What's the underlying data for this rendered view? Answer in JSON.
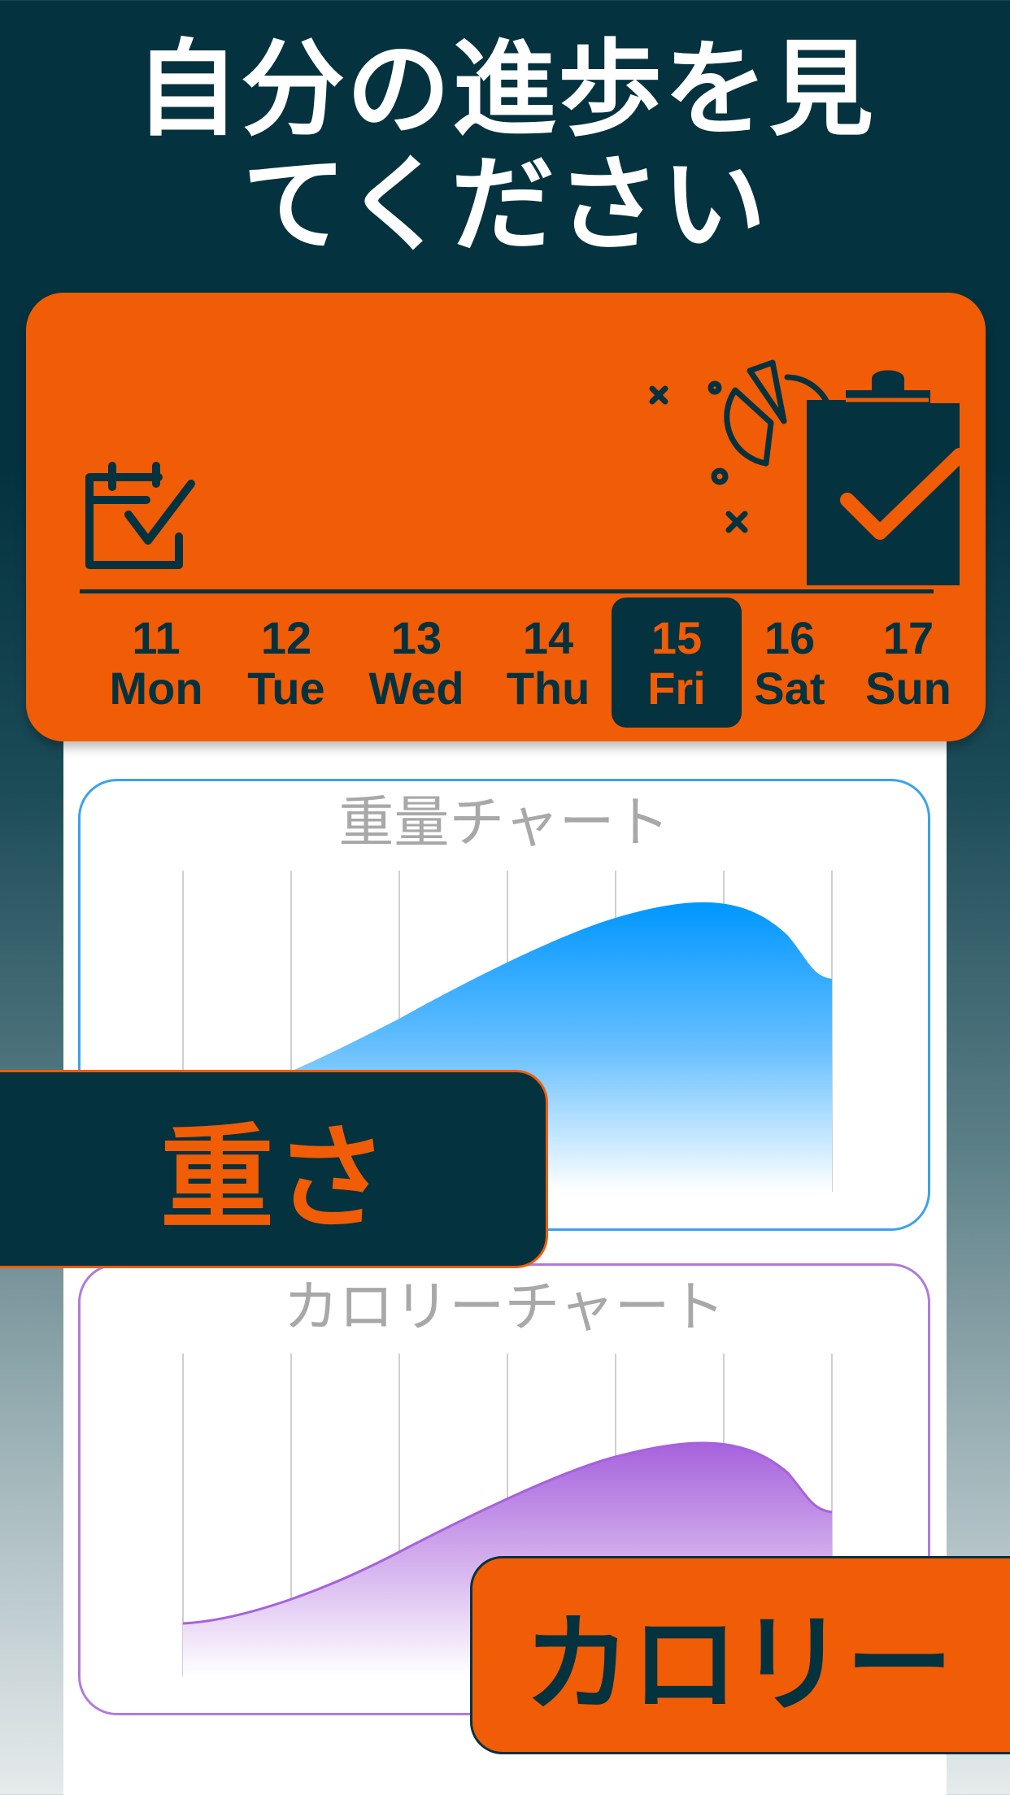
{
  "headline": {
    "line1": "自分の進歩を見",
    "line2": "てください"
  },
  "week": {
    "days": [
      {
        "num": "11",
        "dow": "Mon"
      },
      {
        "num": "12",
        "dow": "Tue"
      },
      {
        "num": "13",
        "dow": "Wed"
      },
      {
        "num": "14",
        "dow": "Thu"
      },
      {
        "num": "15",
        "dow": "Fri"
      },
      {
        "num": "16",
        "dow": "Sat"
      },
      {
        "num": "17",
        "dow": "Sun"
      }
    ],
    "selected_index": 4
  },
  "charts": {
    "weight": {
      "title": "重量チャート",
      "color": "#0096ff"
    },
    "calorie": {
      "title": "カロリーチャート",
      "color": "#a662dc"
    }
  },
  "tags": {
    "weight": "重さ",
    "calorie": "カロリー"
  },
  "colors": {
    "navy": "#04323f",
    "orange": "#f15c06"
  },
  "icons": [
    "calendar-check-icon",
    "clipboard-chart-icon"
  ]
}
